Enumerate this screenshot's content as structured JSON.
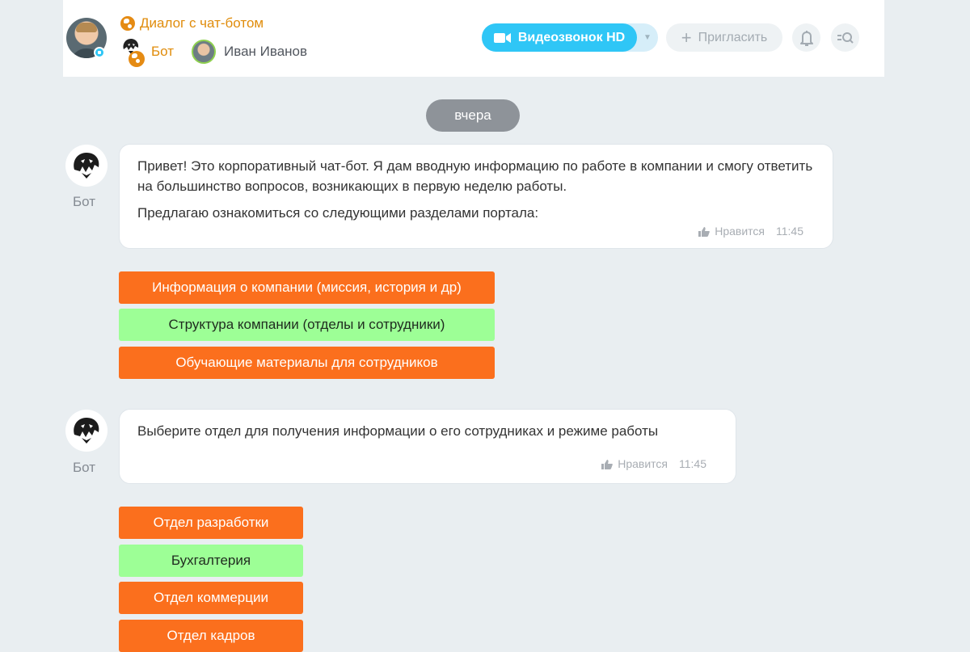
{
  "header": {
    "dialog_title": "Диалог с чат-ботом",
    "bot_name": "Бот",
    "user_name": "Иван Иванов",
    "video_label": "Видеозвонок HD",
    "invite_label": "Пригласить"
  },
  "date_separator": "вчера",
  "messages": [
    {
      "author": "Бот",
      "paragraphs": [
        "Привет! Это корпоративный чат-бот. Я дам вводную информацию по работе в компании и смогу ответить на большинство вопросов, возникающих в первую неделю работы.",
        "Предлагаю ознакомиться со следующими разделами портала:"
      ],
      "like_label": "Нравится",
      "time": "11:45",
      "buttons": [
        {
          "label": "Информация о компании (миссия, история и др)",
          "color": "#fb6f1d"
        },
        {
          "label": "Структура компании (отделы и сотрудники)",
          "color": "#9dff96"
        },
        {
          "label": "Обучающие материалы для сотрудников",
          "color": "#fb6f1d"
        }
      ]
    },
    {
      "author": "Бот",
      "paragraphs": [
        "Выберите отдел для получения информации о его сотрудниках и режиме работы"
      ],
      "like_label": "Нравится",
      "time": "11:45",
      "buttons": [
        {
          "label": "Отдел разработки",
          "color": "#fb6f1d"
        },
        {
          "label": "Бухгалтерия",
          "color": "#9dff96"
        },
        {
          "label": "Отдел коммерции",
          "color": "#fb6f1d"
        },
        {
          "label": "Отдел кадров",
          "color": "#fb6f1d"
        }
      ]
    }
  ],
  "colors": {
    "accent": "#2fc6f6",
    "orange_button": "#fb6f1d",
    "green_button": "#9dff96",
    "title_orange": "#e08c0b",
    "background": "#e9eef1"
  },
  "icons": [
    "globe-icon",
    "camera-icon",
    "plus-icon",
    "bell-icon",
    "search-list-icon",
    "lion-icon",
    "like-icon",
    "chevron-down-icon"
  ]
}
